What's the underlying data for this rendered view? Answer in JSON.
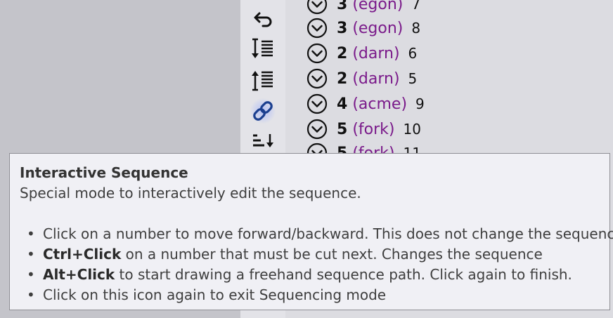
{
  "sequence_list": {
    "rows": [
      {
        "number": "3",
        "name": "(egon)",
        "count": "7"
      },
      {
        "number": "3",
        "name": "(egon)",
        "count": "8"
      },
      {
        "number": "2",
        "name": "(darn)",
        "count": "6"
      },
      {
        "number": "2",
        "name": "(darn)",
        "count": "5"
      },
      {
        "number": "4",
        "name": "(acme)",
        "count": "9"
      },
      {
        "number": "5",
        "name": "(fork)",
        "count": "10"
      },
      {
        "number": "5",
        "name": "(fork)",
        "count": "11"
      }
    ]
  },
  "toolbar": {
    "icons": [
      "undo-icon",
      "sort-down-icon",
      "sort-up-icon",
      "link-icon",
      "sort-bars-icon"
    ],
    "active_icon": "link-icon",
    "active_color": "#1b3f8f"
  },
  "tooltip": {
    "title": "Interactive Sequence",
    "subtitle": "Special mode to interactively edit the sequence.",
    "items": [
      {
        "bold": "",
        "text": "Click on a number to move forward/backward. This does not change the sequence"
      },
      {
        "bold": "Ctrl+Click",
        "text": " on a number that must be cut next. Changes the sequence"
      },
      {
        "bold": "Alt+Click",
        "text": " to start drawing a freehand sequence path. Click again to finish."
      },
      {
        "bold": "",
        "text": "Click on this icon again to exit Sequencing mode"
      }
    ],
    "bullet": "•"
  }
}
